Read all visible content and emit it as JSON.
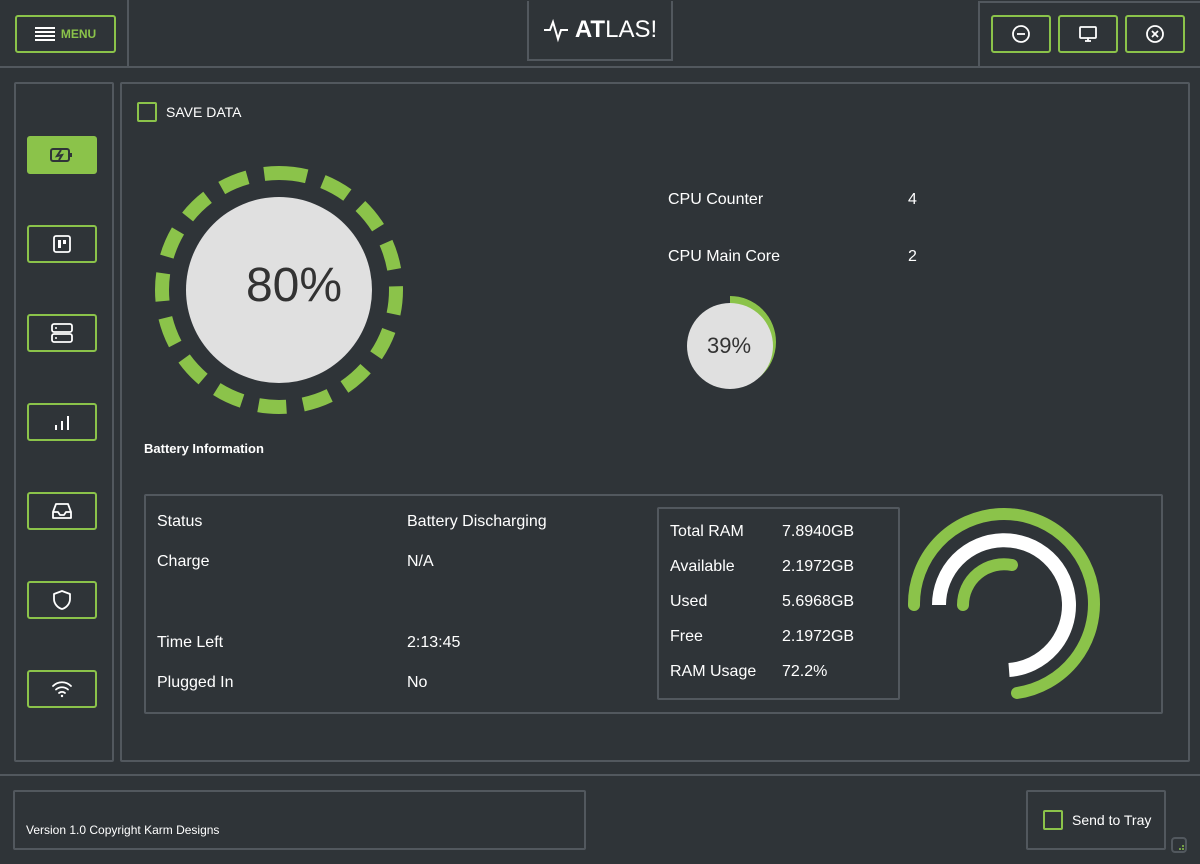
{
  "header": {
    "menu_label": "MENU",
    "title_bold": "AT",
    "title_light": "LAS!"
  },
  "main": {
    "save_data_label": "SAVE DATA",
    "battery_gauge": {
      "percent_label": "80%",
      "value": 0.8
    },
    "cpu": {
      "counter_label": "CPU Counter",
      "counter_value": "4",
      "main_core_label": "CPU Main Core",
      "main_core_value": "2",
      "usage_label": "39%",
      "usage_value": 0.39
    },
    "battery_section_title": "Battery Information",
    "battery_info": [
      {
        "label": "Status",
        "value": "Battery Discharging"
      },
      {
        "label": "Charge",
        "value": "N/A"
      },
      {
        "label": "Time Left",
        "value": "2:13:45"
      },
      {
        "label": "Plugged In",
        "value": "No"
      }
    ],
    "ram_info": [
      {
        "label": "Total RAM",
        "value": "7.8940GB"
      },
      {
        "label": "Available",
        "value": "2.1972GB"
      },
      {
        "label": "Used",
        "value": "5.6968GB"
      },
      {
        "label": "Free",
        "value": "2.1972GB"
      },
      {
        "label": "RAM Usage",
        "value": "72.2%"
      }
    ]
  },
  "footer": {
    "version_text": "Version 1.0 Copyright Karm Designs",
    "send_to_tray_label": "Send to Tray"
  },
  "colors": {
    "accent": "#8bc34a",
    "background": "#2f3438",
    "border": "#52585e",
    "gauge_fill": "#e0e0e0"
  },
  "sidebar_icons": [
    "battery-charging-icon",
    "dashboard-icon",
    "server-icon",
    "bar-chart-icon",
    "inbox-icon",
    "shield-icon",
    "wifi-icon"
  ],
  "window_controls": [
    "minimize-icon",
    "monitor-icon",
    "close-icon"
  ]
}
